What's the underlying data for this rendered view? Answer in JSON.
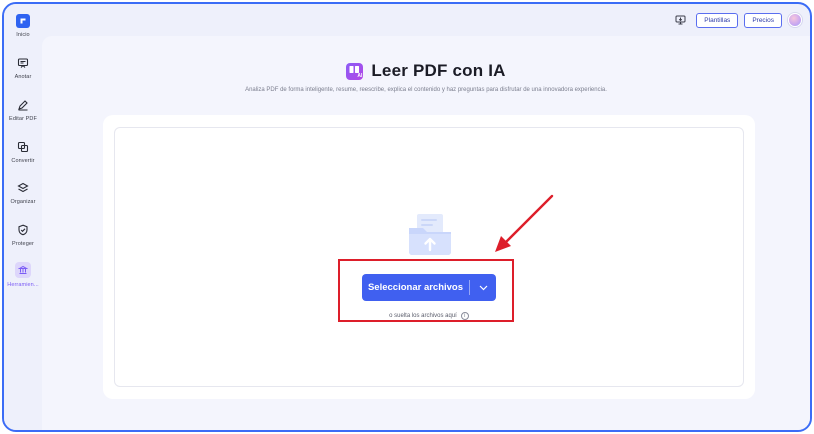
{
  "sidebar": {
    "items": [
      {
        "label": "Inicio",
        "icon": "home-logo-icon"
      },
      {
        "label": "Anotar",
        "icon": "annotate-icon"
      },
      {
        "label": "Editar PDF",
        "icon": "edit-pen-icon"
      },
      {
        "label": "Convertir",
        "icon": "convert-icon"
      },
      {
        "label": "Organizar",
        "icon": "organize-layers-icon"
      },
      {
        "label": "Proteger",
        "icon": "shield-icon"
      },
      {
        "label": "Herramien...",
        "icon": "tools-icon",
        "active": true
      }
    ]
  },
  "topbar": {
    "plantillas_label": "Plantillas",
    "precios_label": "Precios"
  },
  "main": {
    "title": "Leer PDF con IA",
    "title_badge": "AI",
    "subtitle": "Analiza PDF de forma inteligente, resume, reescribe, explica el contenido y haz preguntas para disfrutar de una innovadora experiencia.",
    "select_label": "Seleccionar archivos",
    "drop_hint": "o suelta los archivos aquí",
    "info_glyph": "i"
  },
  "colors": {
    "accent": "#4060f0",
    "frame_border": "#3b6cf6",
    "highlight": "#dd1e2a",
    "tool_active": "#7b5cf5"
  }
}
